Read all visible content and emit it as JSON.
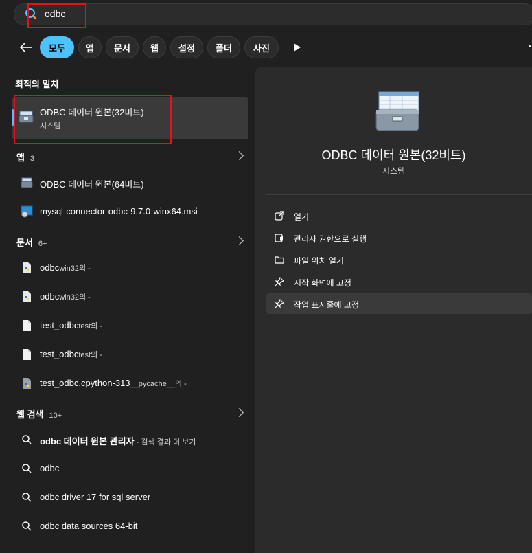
{
  "search": {
    "query": "odbc"
  },
  "filters": [
    "모두",
    "앱",
    "문서",
    "웹",
    "설정",
    "폴더",
    "사진"
  ],
  "best_match": {
    "heading": "최적의 일치",
    "title": "ODBC 데이터 원본(32비트)",
    "subtitle": "시스템"
  },
  "apps": {
    "heading": "앱",
    "count": "3",
    "items": [
      "ODBC 데이터 원본(64비트)",
      "mysql-connector-odbc-9.7.0-winx64.msi"
    ]
  },
  "documents": {
    "heading": "문서",
    "count": "6+",
    "items": [
      {
        "name": "odbc",
        "path": "win32의 -"
      },
      {
        "name": "odbc",
        "path": "win32의 -"
      },
      {
        "name": "test_odbc",
        "path": "test의 -"
      },
      {
        "name": "test_odbc",
        "path": "test의 -"
      },
      {
        "name": "test_odbc.cpython-313",
        "path": "__pycache__의 -"
      }
    ]
  },
  "web": {
    "heading": "웹 검색",
    "count": "10+",
    "items": [
      {
        "text": "odbc 데이터 원본 관리자",
        "suffix": " - 검색 결과 더 보기"
      },
      {
        "text": "odbc",
        "suffix": ""
      },
      {
        "text": "odbc driver 17 for sql server",
        "suffix": ""
      },
      {
        "text": "odbc data sources 64-bit",
        "suffix": ""
      }
    ]
  },
  "detail": {
    "title": "ODBC 데이터 원본(32비트)",
    "subtitle": "시스템",
    "actions": [
      "열기",
      "관리자 권한으로 실행",
      "파일 위치 열기",
      "시작 화면에 고정",
      "작업 표시줄에 고정"
    ]
  },
  "colors": {
    "accent": "#4cc2ff",
    "highlight": "#e8101b",
    "panel": "#2b2b2b",
    "background": "#202020"
  }
}
